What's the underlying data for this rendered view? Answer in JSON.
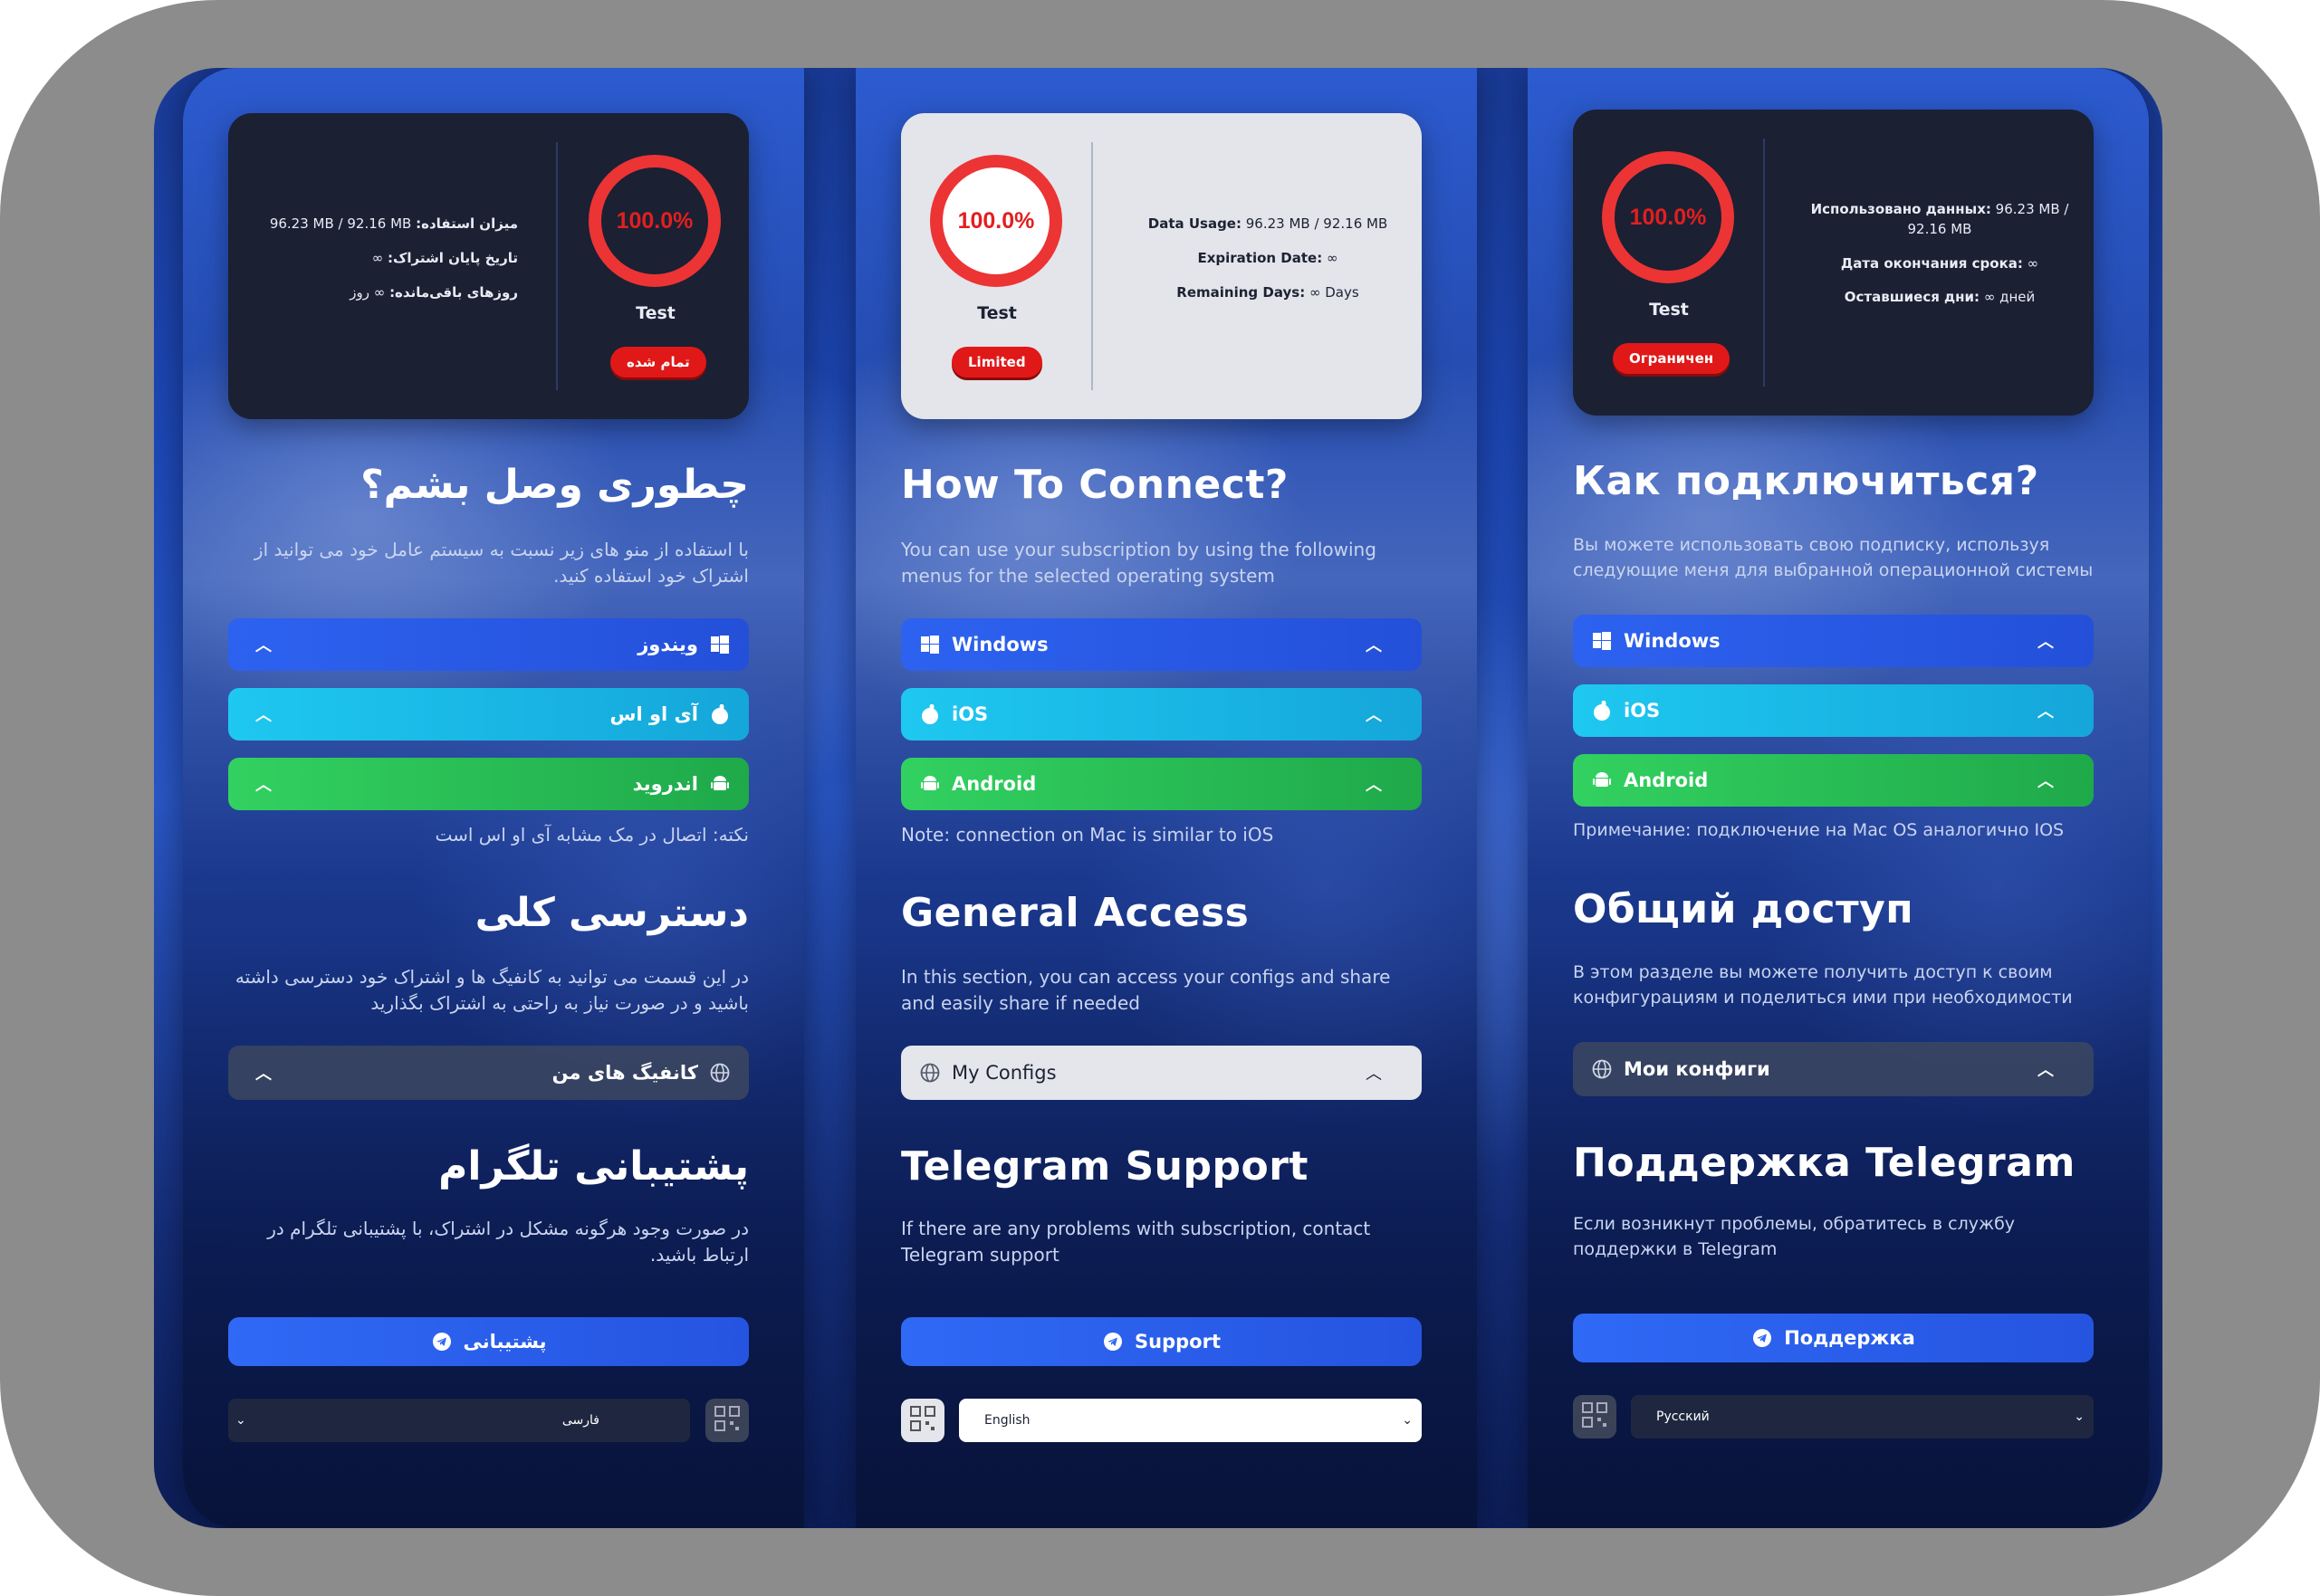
{
  "panels": {
    "fa": {
      "percent": "100.0%",
      "username": "Test",
      "status": "تمام شده",
      "usage_label": "میزان استفاده:",
      "usage_value": "96.23 MB / 92.16 MB",
      "expire_label": "تاریخ پایان اشتراک:",
      "expire_value": "∞",
      "remaining_label": "روزهای باقی‌مانده:",
      "remaining_value": "∞ روز",
      "connect_title": "چطوری وصل بشم؟",
      "connect_desc": "با استفاده از منو های زیر نسبت به سیستم عامل خود می توانید از اشتراک خود استفاده کنید.",
      "windows": "ویندوز",
      "ios": "آی او اس",
      "android": "اندروید",
      "note": "نکته: اتصال در مک مشابه آی او اس است",
      "access_title": "دسترسی کلی",
      "access_desc": "در این قسمت می توانید به کانفیگ ها و اشتراک خود دسترسی داشته باشید و در صورت نیاز به راحتی به اشتراک بگذارید",
      "configs": "کانفیگ های من",
      "support_title": "پشتیبانی تلگرام",
      "support_desc": "در صورت وجود هرگونه مشکل در اشتراک، با پشتیبانی تلگرام در ارتباط باشید.",
      "support_btn": "پشتیبانی",
      "language": "فارسی"
    },
    "en": {
      "percent": "100.0%",
      "username": "Test",
      "status": "Limited",
      "usage_label": "Data Usage:",
      "usage_value": "96.23 MB / 92.16 MB",
      "expire_label": "Expiration Date:",
      "expire_value": "∞",
      "remaining_label": "Remaining Days:",
      "remaining_value": "∞ Days",
      "connect_title": "How To Connect?",
      "connect_desc": "You can use your subscription by using the following menus for the selected operating system",
      "windows": "Windows",
      "ios": "iOS",
      "android": "Android",
      "note": "Note: connection on Mac is similar to iOS",
      "access_title": "General Access",
      "access_desc": "In this section, you can access your configs and share and easily share if needed",
      "configs": "My Configs",
      "support_title": "Telegram Support",
      "support_desc": "If there are any problems with subscription, contact Telegram support",
      "support_btn": "Support",
      "language": "English"
    },
    "ru": {
      "percent": "100.0%",
      "username": "Test",
      "status": "Ограничен",
      "usage_label": "Использовано данных:",
      "usage_value": "96.23 MB / 92.16 MB",
      "expire_label": "Дата окончания срока:",
      "expire_value": "∞",
      "remaining_label": "Оставшиеся дни:",
      "remaining_value": "∞ дней",
      "connect_title": "Как подключиться?",
      "connect_desc": "Вы можете использовать свою подписку, используя следующие меня для выбранной операционной системы",
      "windows": "Windows",
      "ios": "iOS",
      "android": "Android",
      "note": "Примечание: подключение на Mac OS аналогично IOS",
      "access_title": "Общий доступ",
      "access_desc": "В этом разделе вы можете получить доступ к своим конфигурациям и поделиться ими при необходимости",
      "configs": "Мои конфиги",
      "support_title": "Поддержка Telegram",
      "support_desc": "Если возникнут проблемы, обратитесь в службу поддержки в Telegram",
      "support_btn": "Поддержка",
      "language": "Русский"
    }
  },
  "progress": {
    "fa": 1.0,
    "en": 1.0,
    "ru": 1.0
  },
  "colors": {
    "ring": "#ec3434",
    "windows": "#2d62f0",
    "ios": "#1ec8f0",
    "android": "#32d160",
    "support": "#2f69f5",
    "badge": "#e01818"
  },
  "icons": [
    "windows-icon",
    "apple-icon",
    "android-icon",
    "globe-icon",
    "telegram-icon",
    "qr-icon",
    "chevron-up-icon",
    "chevron-down-icon"
  ]
}
